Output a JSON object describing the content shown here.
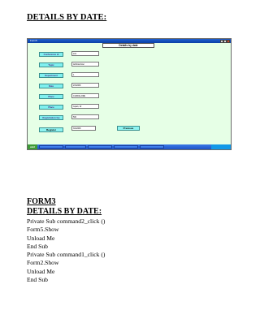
{
  "heading_top": "DETAILS BY DATE:",
  "screenshot": {
    "window_title": "Form5",
    "form_heading": "Details by date",
    "labels": [
      "Conference id",
      "Topic",
      "Department",
      "Date",
      "Place",
      "Place",
      "Registration fee"
    ],
    "fields": [
      "101",
      "Artificial Intel",
      "1",
      "2/3/2008",
      "CUDDALORE",
      "Gpark, Dr",
      "500"
    ],
    "buttons": {
      "register": "Register",
      "previous": "Previous"
    },
    "combo_value": "3/4/2008",
    "taskbar": {
      "start": "start"
    },
    "colors": {
      "form_bg": "#e6ffe6",
      "label_bg": "#7ff0ef",
      "desktop_bg": "#0f7f80"
    }
  },
  "heading_form": "FORM3",
  "heading_sub": "DETAILS BY DATE:",
  "code_lines": [
    "Private Sub command2_click ()",
    "Form5.Show",
    "Unload Me",
    "End Sub",
    "Private Sub command1_click ()",
    "Form2.Show",
    "Unload Me",
    "End Sub"
  ]
}
